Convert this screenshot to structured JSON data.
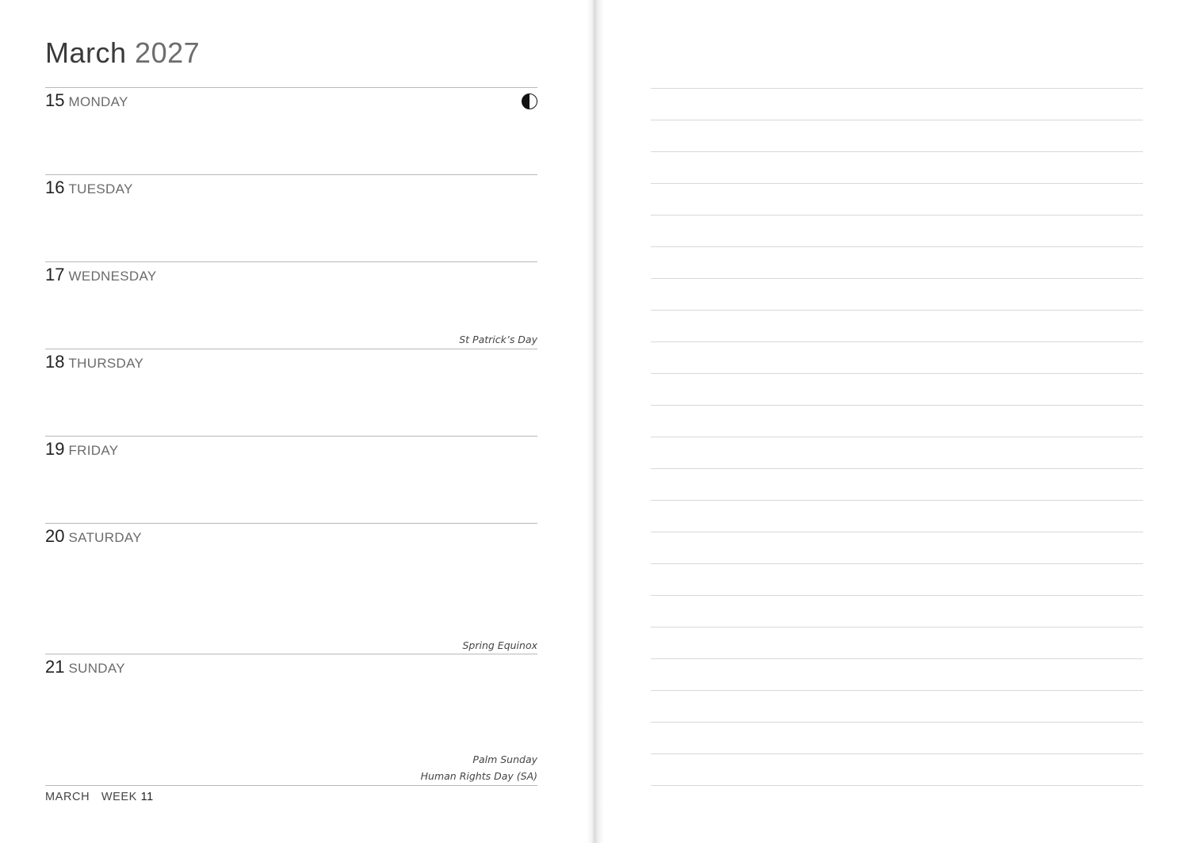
{
  "planner": {
    "month": "March",
    "year": "2027",
    "days": [
      {
        "num": "15",
        "name": "MONDAY",
        "moon": "first-quarter-moon-icon",
        "events": []
      },
      {
        "num": "16",
        "name": "TUESDAY",
        "events": []
      },
      {
        "num": "17",
        "name": "WEDNESDAY",
        "events": [
          "St Patrick’s Day"
        ]
      },
      {
        "num": "18",
        "name": "THURSDAY",
        "events": []
      },
      {
        "num": "19",
        "name": "FRIDAY",
        "events": []
      },
      {
        "num": "20",
        "name": "SATURDAY",
        "events": [
          "Spring Equinox"
        ]
      },
      {
        "num": "21",
        "name": "SUNDAY",
        "events": [
          "Palm Sunday",
          "Human Rights Day (SA)"
        ]
      }
    ],
    "footer": {
      "month_label": "MARCH",
      "week_label": "WEEK",
      "week_number": "11"
    }
  }
}
